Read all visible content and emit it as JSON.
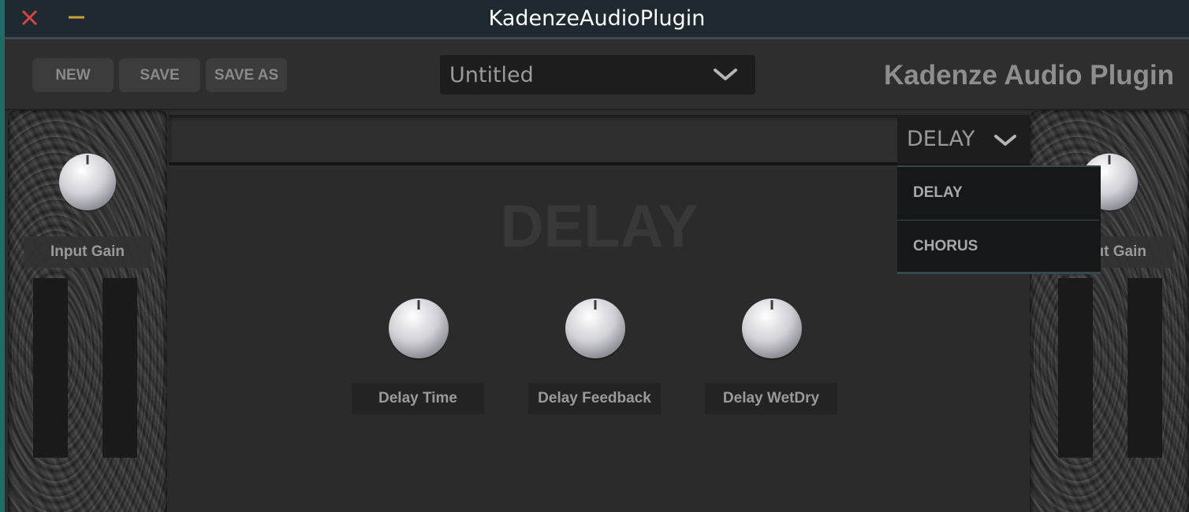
{
  "window": {
    "title": "KadenzeAudioPlugin"
  },
  "header": {
    "buttons": {
      "new": "NEW",
      "save": "SAVE",
      "save_as": "SAVE AS"
    },
    "preset_selector": {
      "value": "Untitled"
    },
    "brand": "Kadenze Audio Plugin"
  },
  "input_panel": {
    "label": "Input Gain"
  },
  "output_panel": {
    "label": "Input Gain"
  },
  "fx_panel": {
    "title": "DELAY",
    "knobs": [
      {
        "label": "Delay Time"
      },
      {
        "label": "Delay Feedback"
      },
      {
        "label": "Delay WetDry"
      }
    ]
  },
  "fx_selector": {
    "value": "DELAY",
    "options": [
      "DELAY",
      "CHORUS"
    ]
  },
  "colors": {
    "background": "#2b2b2b",
    "titlebar": "#1e2a30",
    "close": "#d64545",
    "minimize": "#c9a13b",
    "label_text": "#9a9a9a",
    "dropdown_bg": "#141819"
  }
}
